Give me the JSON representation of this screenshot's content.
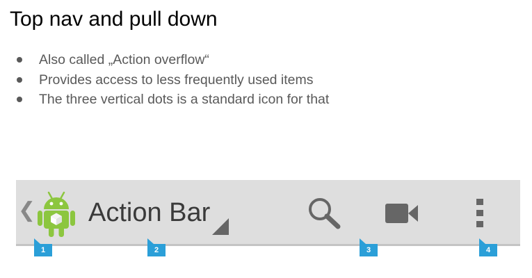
{
  "title": "Top nav and pull down",
  "bullets": [
    "Also called „Action overflow“",
    "Provides access to less frequently used items",
    "The three vertical dots is a standard icon for that"
  ],
  "action_bar": {
    "title": "Action Bar",
    "icons": {
      "up": "chevron-left-icon",
      "app": "android-icon",
      "dropdown": "dropdown-triangle-icon",
      "search": "search-icon",
      "video": "video-camera-icon",
      "overflow": "more-vertical-icon"
    },
    "badges": [
      "1",
      "2",
      "3",
      "4"
    ]
  },
  "colors": {
    "bar_background": "#dedede",
    "bar_text": "#3a3a3a",
    "icon_gray": "#666666",
    "android_green": "#8cc63f",
    "badge_blue": "#2b9fd8",
    "bullet_text": "#595959"
  }
}
